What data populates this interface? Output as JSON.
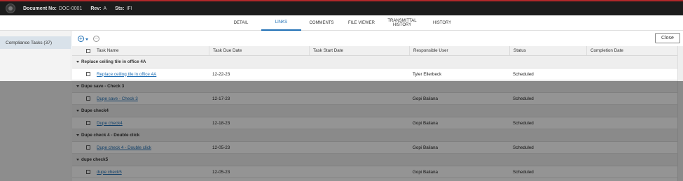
{
  "header": {
    "doc_no_label": "Document No:",
    "doc_no_value": "DOC-0001",
    "rev_label": "Rev:",
    "rev_value": "A",
    "sts_label": "Sts:",
    "sts_value": "IFI"
  },
  "tabs": [
    {
      "label": "DETAIL"
    },
    {
      "label": "LINKS",
      "active": true
    },
    {
      "label": "COMMENTS"
    },
    {
      "label": "FILE VIEWER"
    },
    {
      "label": "TRANSMITTAL HISTORY"
    },
    {
      "label": "HISTORY"
    }
  ],
  "sidebar": {
    "items": [
      {
        "label": "Compliance Tasks (37)"
      }
    ]
  },
  "toolbar": {
    "close_label": "Close"
  },
  "table": {
    "columns": [
      "Task Name",
      "Task Due Date",
      "Task Start Date",
      "Responsible User",
      "Status",
      "Completion Date"
    ],
    "groups": [
      {
        "title": "Replace ceiling tile in office 4A",
        "rows": [
          {
            "name": "Replace ceiling tile in office 4A",
            "due": "12-22-23",
            "start": "",
            "user": "Tyler Ellerbeck",
            "status": "Scheduled",
            "completion": ""
          }
        ]
      },
      {
        "title": "Dupe save - Check 3",
        "rows": [
          {
            "name": "Dupe save - Check 3",
            "due": "12-17-23",
            "start": "",
            "user": "Gopi Baliana",
            "status": "Scheduled",
            "completion": ""
          }
        ]
      },
      {
        "title": "Dupe check4",
        "rows": [
          {
            "name": "Dupe check4",
            "due": "12-18-23",
            "start": "",
            "user": "Gopi Baliana",
            "status": "Scheduled",
            "completion": ""
          }
        ]
      },
      {
        "title": "Dupe check 4 - Double click",
        "rows": [
          {
            "name": "Dupe check 4 - Double click",
            "due": "12-05-23",
            "start": "",
            "user": "Gopi Baliana",
            "status": "Scheduled",
            "completion": ""
          }
        ]
      },
      {
        "title": "dupe check5",
        "rows": [
          {
            "name": "dupe check5",
            "due": "12-05-23",
            "start": "",
            "user": "Gopi Baliana",
            "status": "Scheduled",
            "completion": ""
          }
        ]
      }
    ]
  }
}
